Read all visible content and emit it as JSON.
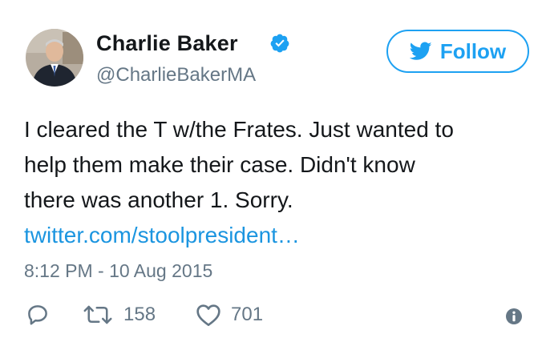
{
  "author": {
    "display_name": "Charlie Baker",
    "handle": "@CharlieBakerMA",
    "verified": true
  },
  "follow_button": {
    "label": "Follow"
  },
  "tweet": {
    "lines": [
      "I cleared the T w/the Frates. Just wanted to",
      "help them make their case. Didn't know",
      "there was another 1. Sorry."
    ],
    "link": "twitter.com/stoolpresident…",
    "timestamp": "8:12 PM - 10 Aug 2015"
  },
  "actions": {
    "reply_icon": "reply-icon",
    "retweet_icon": "retweet-icon",
    "retweet_count": "158",
    "like_icon": "heart-icon",
    "like_count": "701",
    "info_icon": "info-icon"
  },
  "colors": {
    "brand_blue": "#1da1f2",
    "link_blue": "#1b95e0",
    "muted_gray": "#657786",
    "text": "#14171a"
  }
}
